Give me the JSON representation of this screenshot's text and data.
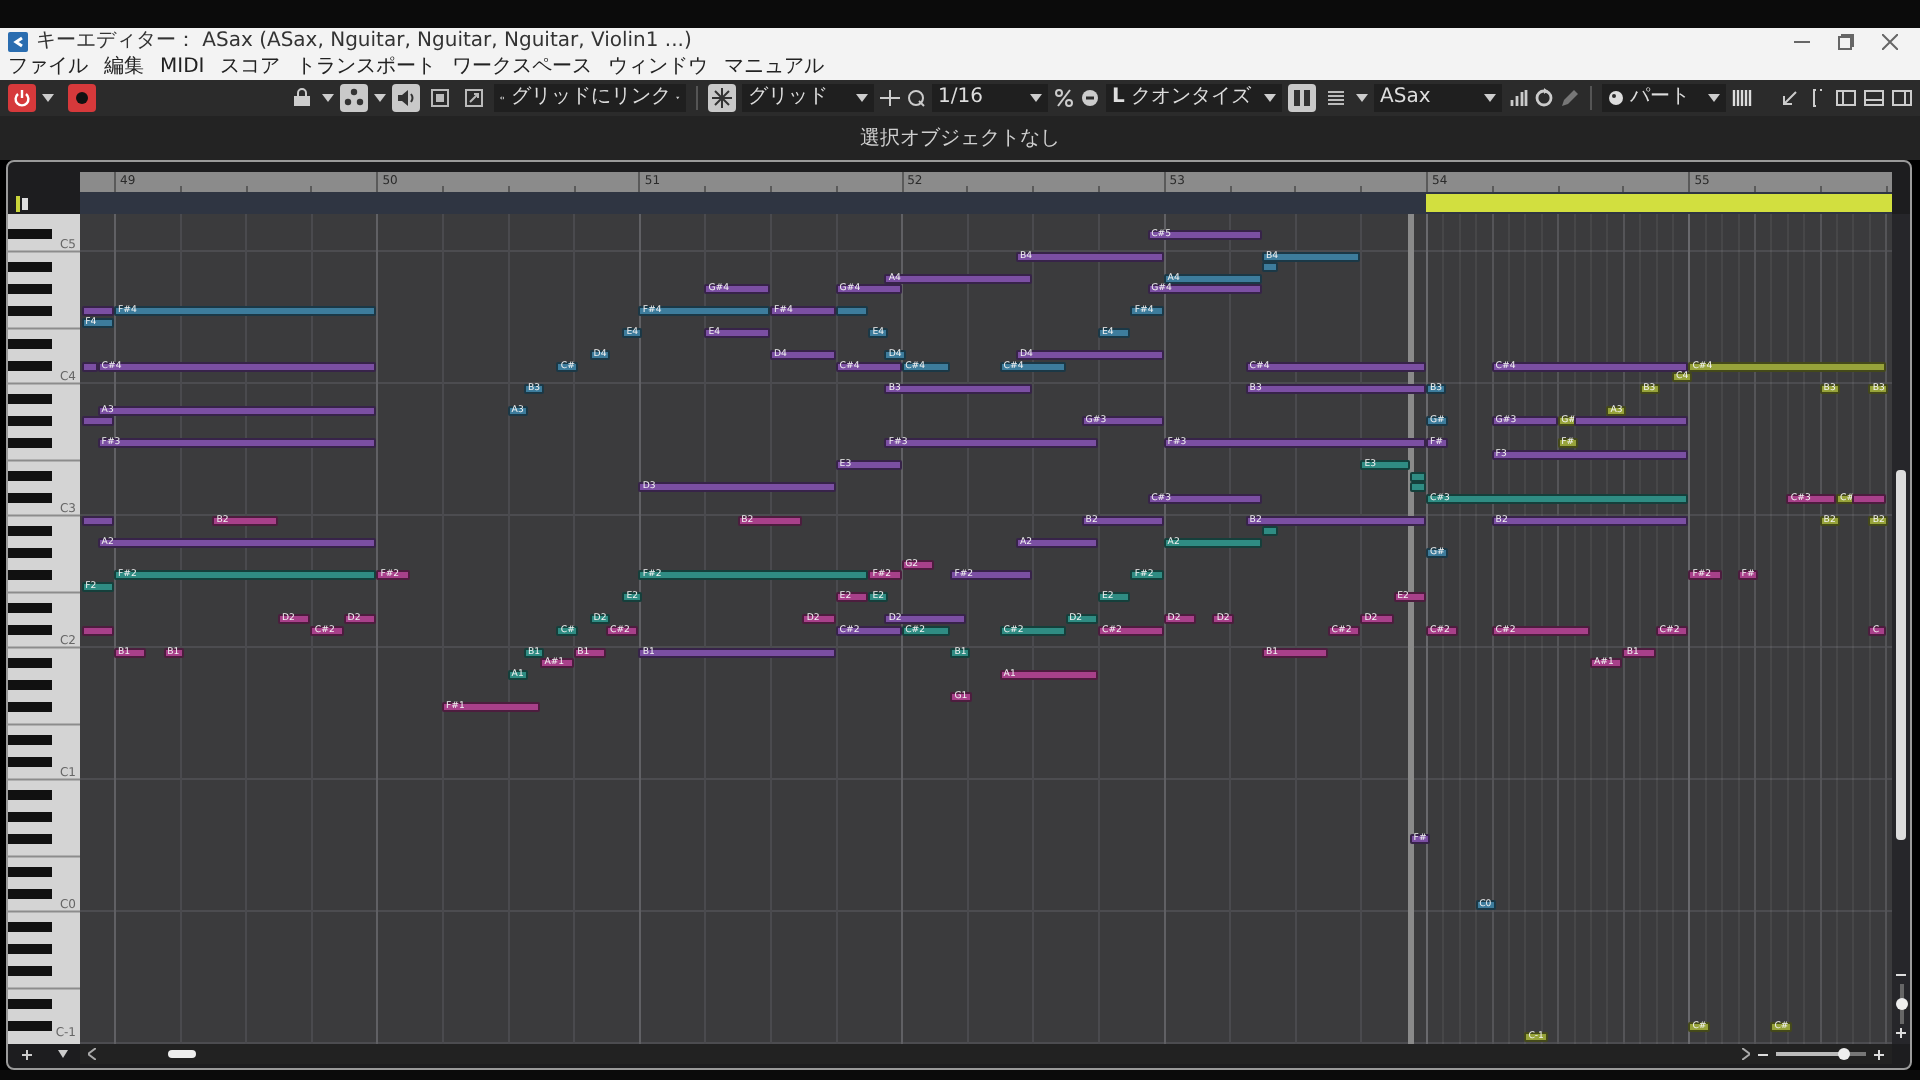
{
  "window": {
    "title": "キーエディター： ASax (ASax, Nguitar, Nguitar, Nguitar, Violin1 ...)"
  },
  "menu": [
    "ファイル",
    "編集",
    "MIDI",
    "スコア",
    "トランスポート",
    "ワークスペース",
    "ウィンドウ",
    "マニュアル"
  ],
  "toolbar": {
    "tool_buttons": [
      {
        "kind": "select",
        "on": false
      },
      {
        "kind": "object",
        "on": true
      },
      {
        "kind": "speaker",
        "on": true
      },
      {
        "kind": "nudge",
        "on": false
      },
      {
        "kind": "zoom",
        "on": false
      }
    ],
    "snap_mode": "グリッドにリンク",
    "snap_on": true,
    "grid_type": "グリッド",
    "grid_value": "1/16",
    "quantize_letter": "L",
    "quantize": "クオンタイズ",
    "layout_buttons": [
      {
        "kind": "lanes",
        "on": true
      },
      {
        "kind": "list",
        "on": false
      }
    ],
    "track": "ASax",
    "color_scheme": "パート"
  },
  "info": "選択オブジェクトなし",
  "ruler": {
    "bars": [
      "49",
      "50",
      "51",
      "52",
      "53",
      "54",
      "55"
    ]
  },
  "keyboard": {
    "labels": [
      "C5",
      "C4",
      "C3",
      "C2",
      "C1",
      "C0",
      "C-1"
    ]
  },
  "notes": [
    {
      "label": "C#5",
      "color": "#7b4fa3"
    },
    {
      "label": "B4",
      "color": "#7b4fa3"
    },
    {
      "label": "B4",
      "color": "#3d7c9c"
    },
    {
      "color": "#3d7c9c"
    },
    {
      "label": "A4",
      "color": "#7b4fa3"
    },
    {
      "label": "A4",
      "color": "#3d7c9c"
    },
    {
      "label": "G#4",
      "color": "#7b4fa3"
    },
    {
      "label": "G#4",
      "color": "#7b4fa3"
    },
    {
      "label": "G#4",
      "color": "#7b4fa3"
    },
    {
      "color": "#7b4fa3"
    },
    {
      "label": "F#4",
      "color": "#3d7c9c"
    },
    {
      "label": "F#4",
      "color": "#3d7c9c"
    },
    {
      "label": "F#4",
      "color": "#7b4fa3"
    },
    {
      "color": "#3d7c9c"
    },
    {
      "label": "F#4",
      "color": "#3d7c9c"
    },
    {
      "label": "F4",
      "color": "#3d7c9c"
    },
    {
      "label": "E4",
      "color": "#3d7c9c"
    },
    {
      "label": "E4",
      "color": "#7b4fa3"
    },
    {
      "label": "E4",
      "color": "#3d7c9c"
    },
    {
      "label": "E4",
      "color": "#3d7c9c"
    },
    {
      "label": "D4",
      "color": "#3d7c9c"
    },
    {
      "label": "D4",
      "color": "#7b4fa3"
    },
    {
      "label": "D4",
      "color": "#3d7c9c"
    },
    {
      "label": "D4",
      "color": "#7b4fa3"
    },
    {
      "color": "#7b4fa3"
    },
    {
      "label": "C#4",
      "color": "#7b4fa3"
    },
    {
      "label": "C#",
      "color": "#3d7c9c"
    },
    {
      "label": "C#4",
      "color": "#7b4fa3"
    },
    {
      "label": "C#4",
      "color": "#3d7c9c"
    },
    {
      "label": "C#4",
      "color": "#3d7c9c"
    },
    {
      "label": "C#4",
      "color": "#7b4fa3"
    },
    {
      "label": "C#4",
      "color": "#7b4fa3"
    },
    {
      "label": "C#4",
      "color": "#97a33a"
    },
    {
      "label": "C4",
      "color": "#97a33a"
    },
    {
      "label": "B3",
      "color": "#3d7c9c"
    },
    {
      "label": "B3",
      "color": "#7b4fa3"
    },
    {
      "label": "B3",
      "color": "#7b4fa3"
    },
    {
      "label": "B3",
      "color": "#3d7c9c"
    },
    {
      "label": "B3",
      "color": "#97a33a"
    },
    {
      "label": "B3",
      "color": "#97a33a"
    },
    {
      "label": "B3",
      "color": "#97a33a"
    },
    {
      "label": "A3",
      "color": "#7b4fa3"
    },
    {
      "label": "A3",
      "color": "#3d7c9c"
    },
    {
      "label": "A3",
      "color": "#97a33a"
    },
    {
      "color": "#7b4fa3"
    },
    {
      "label": "G#3",
      "color": "#7b4fa3"
    },
    {
      "label": "G#",
      "color": "#3d7c9c"
    },
    {
      "label": "G#3",
      "color": "#7b4fa3"
    },
    {
      "label": "G#",
      "color": "#97a33a"
    },
    {
      "color": "#7b4fa3"
    },
    {
      "label": "F#3",
      "color": "#7b4fa3"
    },
    {
      "label": "F#3",
      "color": "#7b4fa3"
    },
    {
      "label": "F#3",
      "color": "#7b4fa3"
    },
    {
      "label": "F#",
      "color": "#7b4fa3"
    },
    {
      "label": "F#",
      "color": "#97a33a"
    },
    {
      "label": "F3",
      "color": "#7b4fa3"
    },
    {
      "label": "E3",
      "color": "#7b4fa3"
    },
    {
      "label": "E3",
      "color": "#2f8c83"
    },
    {
      "color": "#2f8c83"
    },
    {
      "label": "D3",
      "color": "#7b4fa3"
    },
    {
      "color": "#2f8c83"
    },
    {
      "label": "C#3",
      "color": "#7b4fa3"
    },
    {
      "label": "C#3",
      "color": "#2f8c83"
    },
    {
      "label": "C#3",
      "color": "#a8408a"
    },
    {
      "label": "C#",
      "color": "#97a33a"
    },
    {
      "color": "#a8408a"
    },
    {
      "color": "#7b4fa3"
    },
    {
      "label": "B2",
      "color": "#a8408a"
    },
    {
      "label": "B2",
      "color": "#a8408a"
    },
    {
      "label": "B2",
      "color": "#7b4fa3"
    },
    {
      "label": "B2",
      "color": "#7b4fa3"
    },
    {
      "label": "B2",
      "color": "#7b4fa3"
    },
    {
      "label": "B2",
      "color": "#97a33a"
    },
    {
      "label": "B2",
      "color": "#97a33a"
    },
    {
      "color": "#2f8c83"
    },
    {
      "label": "A2",
      "color": "#7b4fa3"
    },
    {
      "label": "A2",
      "color": "#7b4fa3"
    },
    {
      "label": "A2",
      "color": "#2f8c83"
    },
    {
      "label": "G#",
      "color": "#3d7c9c"
    },
    {
      "label": "G2",
      "color": "#a8408a"
    },
    {
      "label": "F#2",
      "color": "#2f8c83"
    },
    {
      "label": "F#2",
      "color": "#a8408a"
    },
    {
      "label": "F#2",
      "color": "#2f8c83"
    },
    {
      "label": "F#2",
      "color": "#a8408a"
    },
    {
      "label": "F#2",
      "color": "#7b4fa3"
    },
    {
      "label": "F#2",
      "color": "#2f8c83"
    },
    {
      "label": "F#2",
      "color": "#a8408a"
    },
    {
      "label": "F#",
      "color": "#a8408a"
    },
    {
      "label": "F2",
      "color": "#2f8c83"
    },
    {
      "label": "E2",
      "color": "#2f8c83"
    },
    {
      "label": "E2",
      "color": "#a8408a"
    },
    {
      "label": "E2",
      "color": "#2f8c83"
    },
    {
      "label": "E2",
      "color": "#2f8c83"
    },
    {
      "label": "E2",
      "color": "#a8408a"
    },
    {
      "label": "D2",
      "color": "#a8408a"
    },
    {
      "label": "D2",
      "color": "#a8408a"
    },
    {
      "label": "D2",
      "color": "#2f8c83"
    },
    {
      "label": "D2",
      "color": "#a8408a"
    },
    {
      "label": "D2",
      "color": "#7b4fa3"
    },
    {
      "label": "D2",
      "color": "#2f8c83"
    },
    {
      "label": "D2",
      "color": "#a8408a"
    },
    {
      "label": "D2",
      "color": "#a8408a"
    },
    {
      "label": "D2",
      "color": "#a8408a"
    },
    {
      "color": "#a8408a"
    },
    {
      "label": "C#2",
      "color": "#a8408a"
    },
    {
      "label": "C#",
      "color": "#2f8c83"
    },
    {
      "label": "C#2",
      "color": "#a8408a"
    },
    {
      "label": "C#2",
      "color": "#7b4fa3"
    },
    {
      "label": "C#2",
      "color": "#2f8c83"
    },
    {
      "label": "C#2",
      "color": "#2f8c83"
    },
    {
      "label": "C#2",
      "color": "#a8408a"
    },
    {
      "label": "C#2",
      "color": "#a8408a"
    },
    {
      "label": "C#2",
      "color": "#a8408a"
    },
    {
      "label": "C#2",
      "color": "#a8408a"
    },
    {
      "label": "C#2",
      "color": "#a8408a"
    },
    {
      "label": "C",
      "color": "#a8408a"
    },
    {
      "label": "B1",
      "color": "#a8408a"
    },
    {
      "label": "B1",
      "color": "#a8408a"
    },
    {
      "label": "B1",
      "color": "#2f8c83"
    },
    {
      "label": "B1",
      "color": "#a8408a"
    },
    {
      "label": "B1",
      "color": "#7b4fa3"
    },
    {
      "label": "B1",
      "color": "#2f8c83"
    },
    {
      "label": "B1",
      "color": "#a8408a"
    },
    {
      "label": "B1",
      "color": "#a8408a"
    },
    {
      "label": "A#1",
      "color": "#a8408a"
    },
    {
      "label": "A#1",
      "color": "#a8408a"
    },
    {
      "label": "A1",
      "color": "#2f8c83"
    },
    {
      "label": "A1",
      "color": "#a8408a"
    },
    {
      "label": "G1",
      "color": "#a8408a"
    },
    {
      "label": "F#1",
      "color": "#a8408a"
    },
    {
      "label": "F#",
      "color": "#7b4fa3"
    },
    {
      "label": "C0",
      "color": "#3d7c9c"
    },
    {
      "label": "C#",
      "color": "#97a33a"
    },
    {
      "label": "C#",
      "color": "#97a33a"
    },
    {
      "label": "C-1",
      "color": "#97a33a"
    }
  ],
  "horizontal_zoom": {
    "level": 0.75
  },
  "vertical_zoom": {
    "level": 0.5
  }
}
